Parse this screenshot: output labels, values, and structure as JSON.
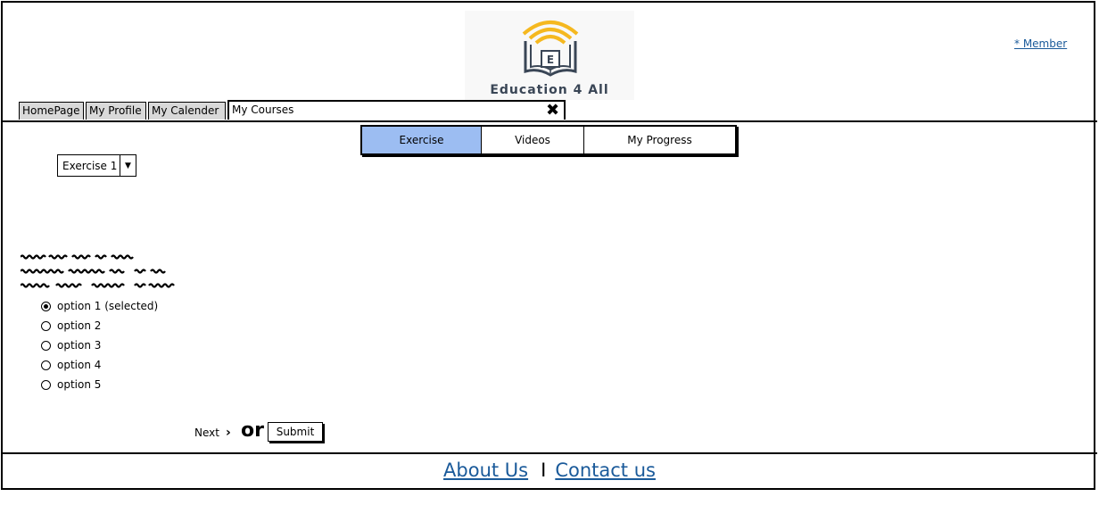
{
  "header": {
    "logo_text": "Education 4 All",
    "member_link": "* Member",
    "logo_colors": {
      "signal": "#f5b81f",
      "book": "#3a4656"
    }
  },
  "nav_tabs": [
    {
      "label": "HomePage",
      "active": false
    },
    {
      "label": "My Profile",
      "active": false
    },
    {
      "label": "My Calender",
      "active": false
    },
    {
      "label": "My Courses",
      "active": true
    }
  ],
  "sub_tabs": [
    {
      "label": "Exercise",
      "selected": true
    },
    {
      "label": "Videos",
      "selected": false
    },
    {
      "label": "My Progress",
      "selected": false
    }
  ],
  "exercise_select": {
    "value": "Exercise 1"
  },
  "question": {
    "options": [
      {
        "label": "option 1 (selected)",
        "selected": true
      },
      {
        "label": "option 2",
        "selected": false
      },
      {
        "label": "option 3",
        "selected": false
      },
      {
        "label": "option 4",
        "selected": false
      },
      {
        "label": "option 5",
        "selected": false
      }
    ]
  },
  "actions": {
    "next_label": "Next",
    "or_label": "or",
    "submit_label": "Submit"
  },
  "footer": {
    "about_label": "About Us",
    "separator": "I",
    "contact_label": "Contact us"
  },
  "colors": {
    "selected_tab": "#9cbdf2",
    "link": "#1a5a9a",
    "inactive_tab": "#d9d9d9"
  }
}
